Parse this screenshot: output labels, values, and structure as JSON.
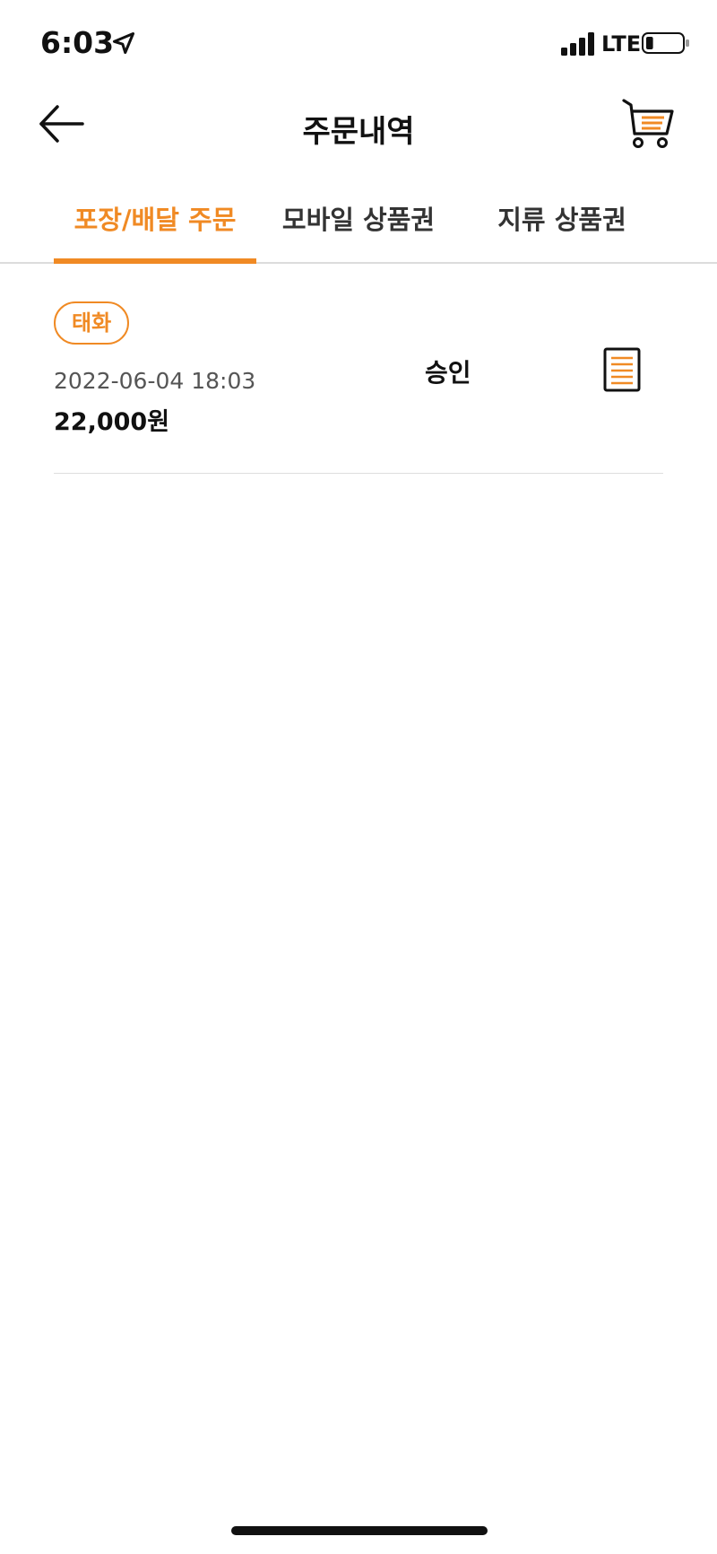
{
  "status_bar": {
    "time": "6:03",
    "network": "LTE",
    "battery_level": 0.2
  },
  "header": {
    "title": "주문내역",
    "back_icon": "arrow-left-icon",
    "cart_icon": "cart-icon"
  },
  "tabs": [
    {
      "label": "포장/배달 주문",
      "active": true
    },
    {
      "label": "모바일 상품권",
      "active": false
    },
    {
      "label": "지류 상품권",
      "active": false
    }
  ],
  "orders": [
    {
      "store": "태화",
      "datetime": "2022-06-04 18:03",
      "amount": "22,000원",
      "status": "승인",
      "receipt_icon": "receipt-icon"
    }
  ],
  "colors": {
    "accent": "#f08a24",
    "text": "#111111",
    "muted": "#555555",
    "divider": "#dedede"
  }
}
